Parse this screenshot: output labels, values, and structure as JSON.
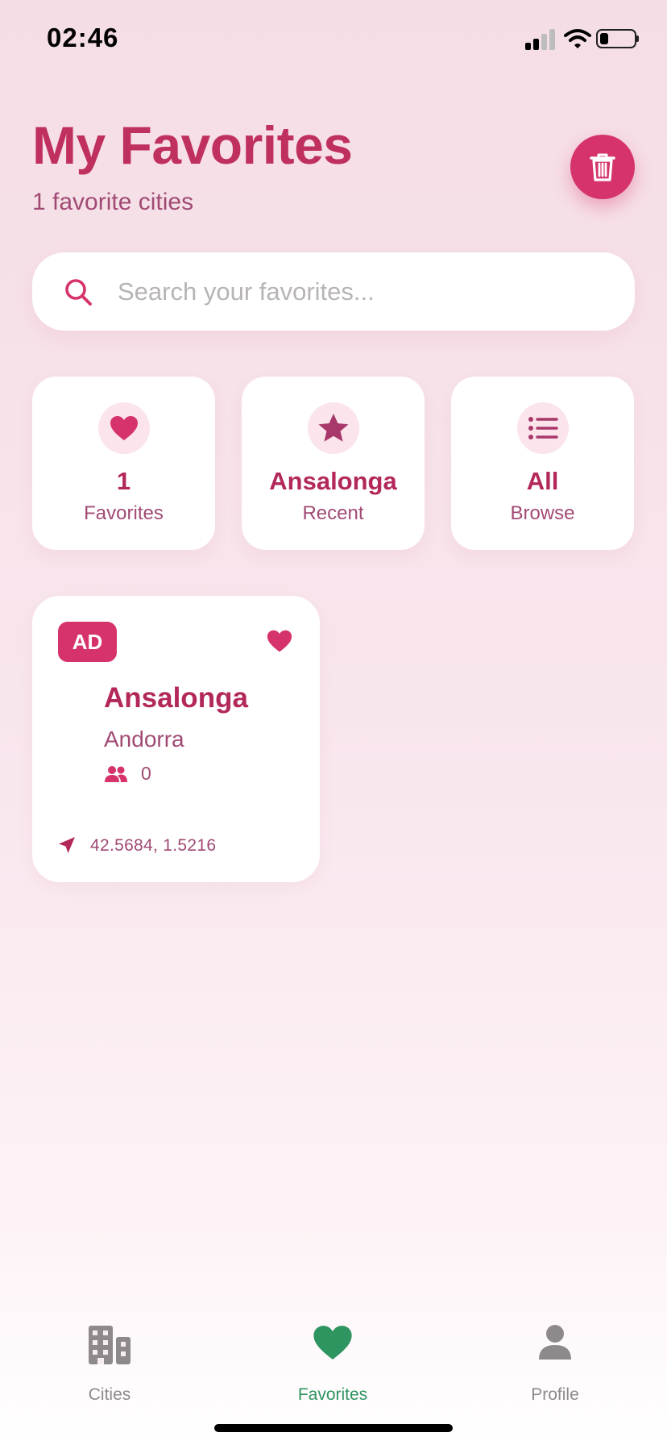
{
  "status_bar": {
    "time": "02:46"
  },
  "header": {
    "title": "My Favorites",
    "subtitle": "1 favorite cities",
    "trash_icon": "trash-icon"
  },
  "search": {
    "placeholder": "Search your favorites...",
    "value": "",
    "icon": "search-icon"
  },
  "stats": [
    {
      "icon": "heart-icon",
      "value": "1",
      "label": "Favorites"
    },
    {
      "icon": "star-icon",
      "value": "Ansalonga",
      "label": "Recent"
    },
    {
      "icon": "list-icon",
      "value": "All",
      "label": "Browse"
    }
  ],
  "cities": [
    {
      "country_code": "AD",
      "name": "Ansalonga",
      "country": "Andorra",
      "population": "0",
      "coordinates": "42.5684, 1.5216",
      "favorited": true
    }
  ],
  "tabs": [
    {
      "label": "Cities",
      "icon": "building-icon",
      "active": false
    },
    {
      "label": "Favorites",
      "icon": "heart-icon",
      "active": true
    },
    {
      "label": "Profile",
      "icon": "user-icon",
      "active": false
    }
  ],
  "colors": {
    "accent": "#d6336c",
    "title": "#c0305f",
    "text_secondary": "#a14a74",
    "tab_active": "#2e9460",
    "tab_inactive": "#8e8a8c"
  }
}
